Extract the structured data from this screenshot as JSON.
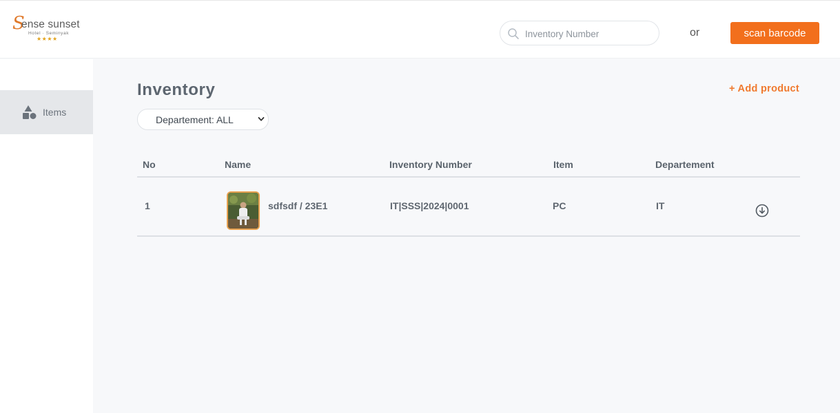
{
  "brand": {
    "script_letter": "S",
    "name": "ense sunset",
    "subtitle": "Hotel · Seminyak",
    "stars": "★★★★"
  },
  "header": {
    "search_placeholder": "Inventory Number",
    "or_text": "or",
    "scan_button": "scan barcode",
    "accent_color": "#f26f1c"
  },
  "sidebar": {
    "items": [
      {
        "label": "Items",
        "icon": "shapes-icon",
        "active": true
      }
    ]
  },
  "main": {
    "title": "Inventory",
    "add_product": "+ Add product",
    "department_filter": {
      "selected": "Departement: ALL",
      "options": [
        "Departement: ALL"
      ]
    },
    "table": {
      "columns": [
        "No",
        "Name",
        "Inventory Number",
        "Item",
        "Departement"
      ],
      "rows": [
        {
          "no": "1",
          "name": "sdfsdf / 23E1",
          "inventory_number": "IT|SSS|2024|0001",
          "item": "PC",
          "department": "IT",
          "thumbnail": "product-photo",
          "action_icon": "download-circle-icon"
        }
      ]
    }
  }
}
